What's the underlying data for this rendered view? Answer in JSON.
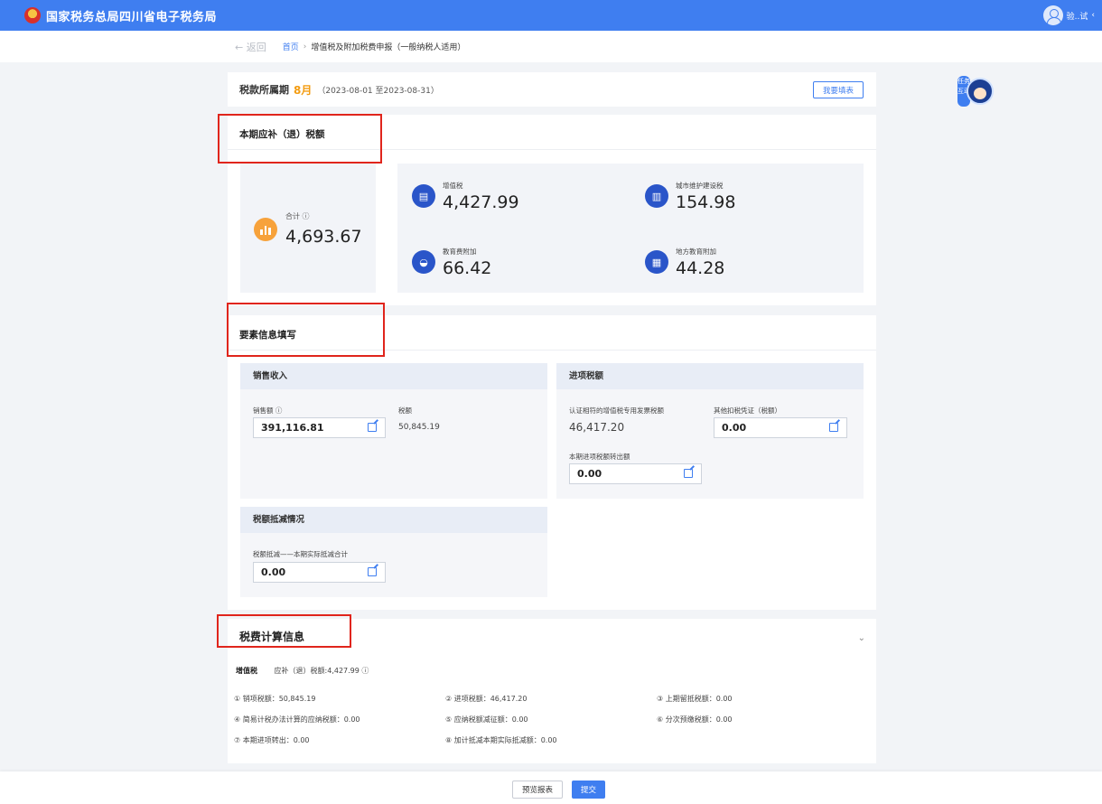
{
  "header": {
    "site_title": "国家税务总局四川省电子税务局",
    "user_name": "验..试",
    "user_chevron": "‹"
  },
  "breadcrumb": {
    "back": "← 返回",
    "home": "首页",
    "sep": "›",
    "current": "增值税及附加税费申报（一般纳税人适用）"
  },
  "period": {
    "label": "税款所属期",
    "month": "8月",
    "range": "（2023-08-01 至2023-08-31）",
    "fill_button": "我要填表"
  },
  "helper": {
    "text": "任务互动"
  },
  "tax_due": {
    "title": "本期应补（退）税额",
    "total_label": "合计 ⓘ",
    "total_value": "4,693.67",
    "items": [
      {
        "label": "增值税",
        "value": "4,427.99",
        "icon": "invoice-icon"
      },
      {
        "label": "城市维护建设税",
        "value": "154.98",
        "icon": "building-icon"
      },
      {
        "label": "教育费附加",
        "value": "66.42",
        "icon": "graduation-cap-icon"
      },
      {
        "label": "地方教育附加",
        "value": "44.28",
        "icon": "book-icon"
      }
    ]
  },
  "elements": {
    "title": "要素信息填写",
    "sales": {
      "heading": "销售收入",
      "sales_label": "销售额 ⓘ",
      "sales_value": "391,116.81",
      "tax_label": "税额",
      "tax_value": "50,845.19"
    },
    "input_tax": {
      "heading": "进项税额",
      "certified_label": "认证相符的增值税专用发票税额",
      "certified_value": "46,417.20",
      "other_label": "其他扣税凭证（税额）",
      "other_value": "0.00",
      "transfer_label": "本期进项税额转出额",
      "transfer_value": "0.00"
    },
    "deduction": {
      "heading": "税额抵减情况",
      "label": "税额抵减——本期实际抵减合计",
      "value": "0.00"
    }
  },
  "calc": {
    "title": "税费计算信息",
    "chevron": "⌄",
    "vat_name": "增值税",
    "vat_due": "应补（退）税额:4,427.99 ⓘ",
    "items": [
      "① 销项税额：50,845.19",
      "② 进项税额：46,417.20",
      "③ 上期留抵税额：0.00",
      "④ 简易计税办法计算的应纳税额：0.00",
      "⑤ 应纳税额减征额：0.00",
      "⑥ 分次预缴税额：0.00",
      "⑦ 本期进项转出：0.00",
      "⑧ 加计抵减本期实际抵减额：0.00"
    ]
  },
  "footer": {
    "preview": "预览报表",
    "submit": "提交"
  },
  "colors": {
    "brand_blue": "#3f7ef0",
    "accent_orange": "#f39c12",
    "annotation_red": "#e0251c"
  }
}
